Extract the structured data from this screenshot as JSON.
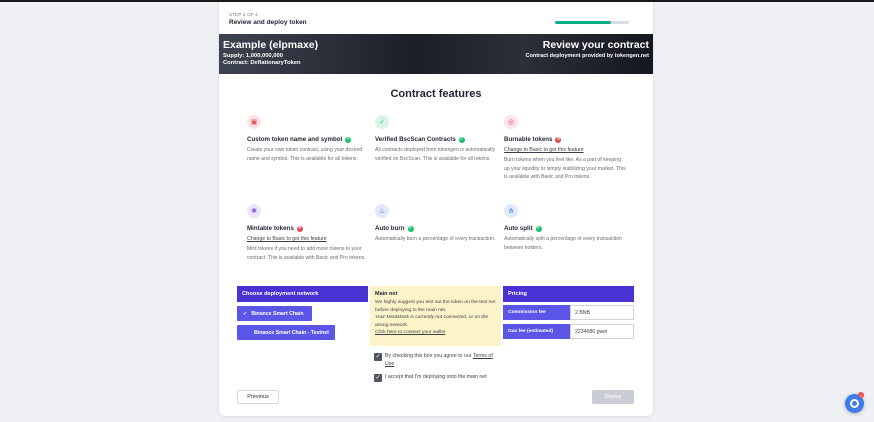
{
  "header": {
    "step_label": "STEP 3 OF 4",
    "step_title": "Review and deploy token",
    "progress": 0.75
  },
  "banner": {
    "token_name": "Example (elpmaxe)",
    "supply": "Supply: 1,000,000,000",
    "contract": "Contract: DeflationaryToken",
    "review_title": "Review your contract",
    "review_sub": "Contract deployment provided by tokengen.net"
  },
  "features": {
    "title": "Contract features",
    "items": [
      {
        "title": "Custom token name and symbol",
        "status": "ok",
        "icon": "file-icon",
        "link": "",
        "desc": "Create your own token contract, using your desired name and symbol. This is available for all tokens."
      },
      {
        "title": "Verified BscScan Contracts",
        "status": "ok",
        "icon": "verified-icon",
        "link": "",
        "desc": "All contracts deployed from tokengen is automatically verified on BscScan. This is available for all tokens."
      },
      {
        "title": "Burnable tokens",
        "status": "no",
        "icon": "burn-icon",
        "link": "Change to Basic to get this feature",
        "desc": "Burn tokens when you feel like. As a part of keeping up your liquidity or simply stabilizing your market. This is available with Basic and Pro tokens."
      },
      {
        "title": "Mintable tokens",
        "status": "no",
        "icon": "mint-icon",
        "link": "Change to Basic to get this feature",
        "desc": "Mint tokens if you need to add more tokens to your contract. This is available with Basic and Pro tokens."
      },
      {
        "title": "Auto burn",
        "status": "ok",
        "icon": "flame-icon",
        "link": "",
        "desc": "Automatically burn a percentage of every transaction."
      },
      {
        "title": "Auto split",
        "status": "ok",
        "icon": "split-icon",
        "link": "",
        "desc": "Automatically split a percentage of every transaction between holders."
      }
    ]
  },
  "network": {
    "heading": "Choose deployment network",
    "options": [
      "Binance Smart Chain",
      "Binance Smart Chain - Testnet"
    ],
    "selected_mark": "✓"
  },
  "mainnet": {
    "title": "Main net",
    "text": "We highly suggest you test out the token on the test net before deploying to the main net.",
    "warning": "Your MetaMask is currently not connected, or on the wrong network.",
    "link": "Click here to connect your wallet"
  },
  "pricing": {
    "heading": "Pricing",
    "rows": [
      {
        "label": "Commission fee",
        "value": "2 BNB"
      },
      {
        "label": "Gas fee (estimated)",
        "value": "2234686 gwei"
      }
    ]
  },
  "agreements": {
    "terms_prefix": "By checking this box you agree to our",
    "terms_link": "Terms of Use",
    "mainnet_ack": "I accept that I'm deploying onto the main net"
  },
  "actions": {
    "previous": "Previous",
    "deploy": "Deploy"
  },
  "chat": {
    "badge": "1"
  },
  "colors": {
    "accent": "#5b56e8",
    "panel_head": "#4a33d4",
    "progress": "#0fae8a",
    "ok": "#1fbf6f",
    "error": "#e5484d"
  }
}
